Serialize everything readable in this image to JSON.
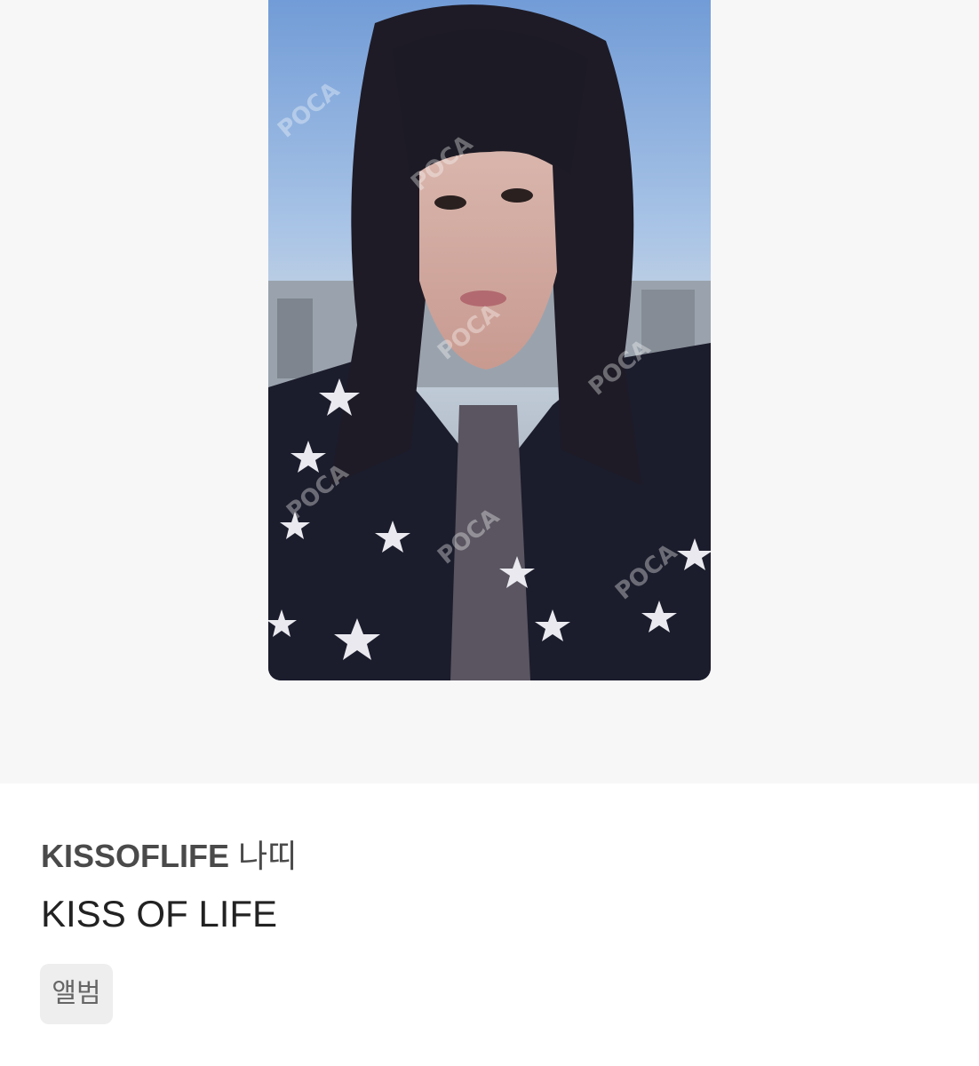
{
  "photocard": {
    "alt": "KISSOFLIFE 나띠 photocard",
    "watermark": "POCA 포카마켓"
  },
  "item": {
    "group": "KISSOFLIFE",
    "member": "나띠",
    "album": "KISS OF LIFE",
    "tag": "앨범"
  }
}
